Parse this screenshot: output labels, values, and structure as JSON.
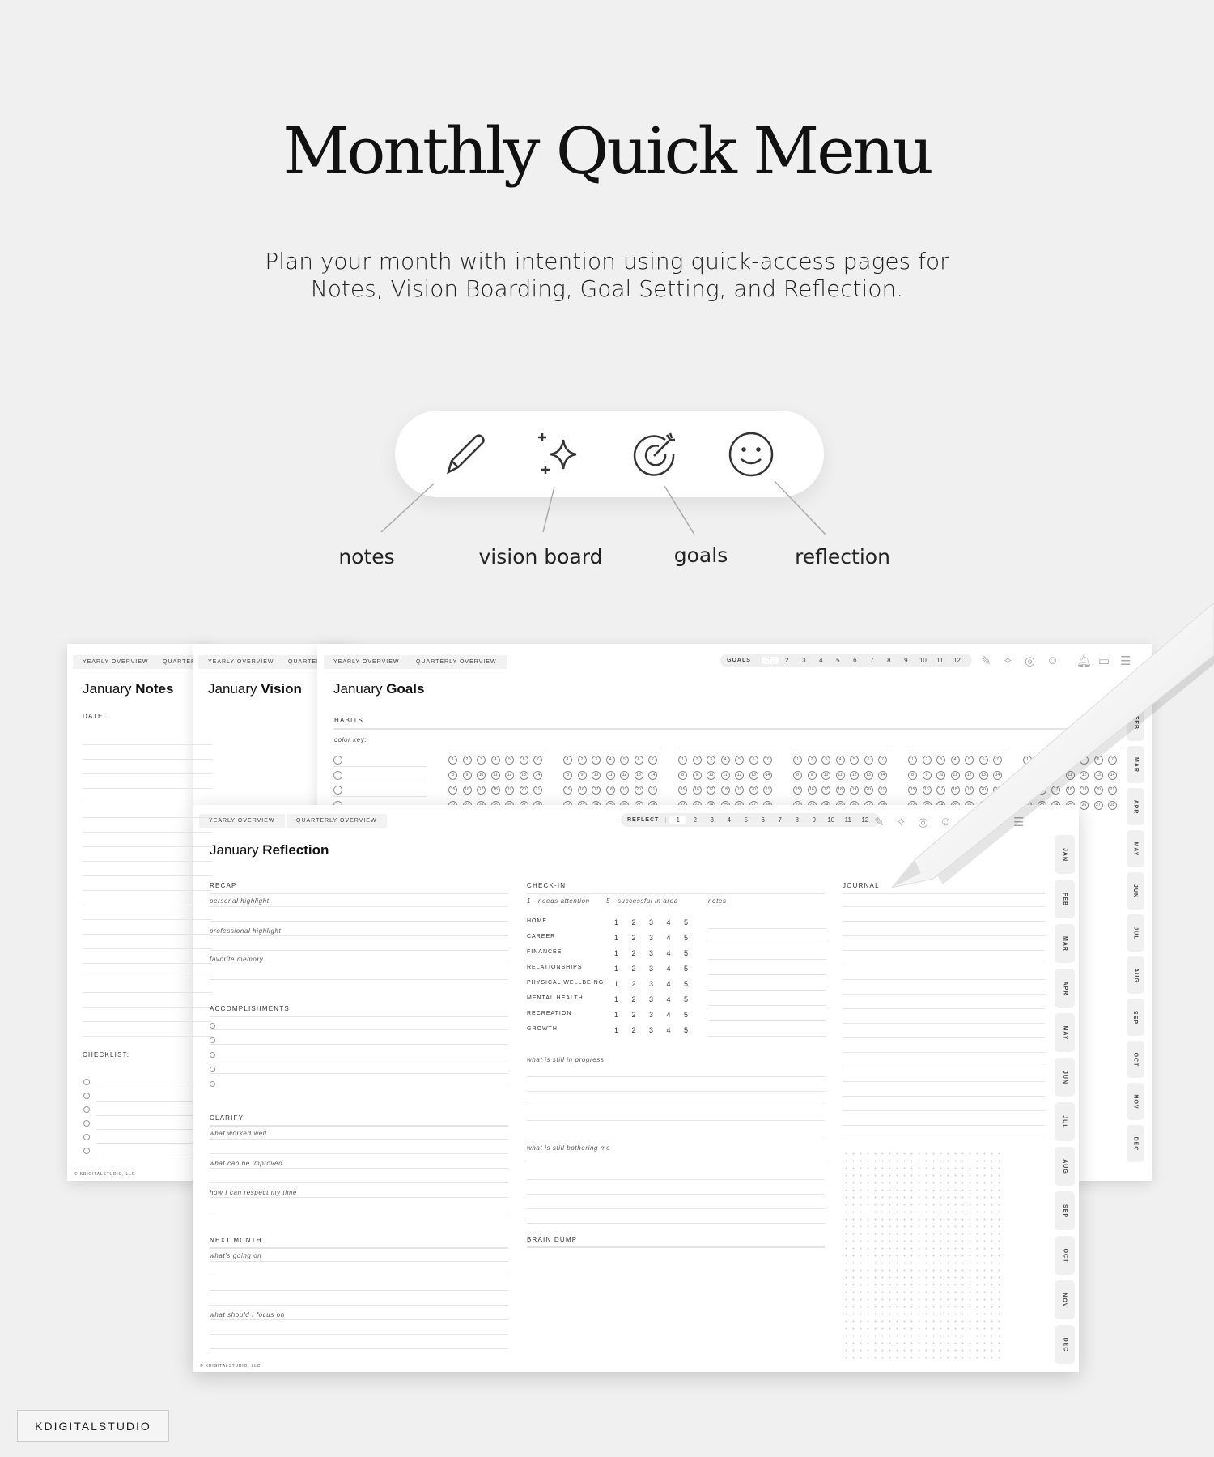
{
  "hero": {
    "title": "Monthly Quick Menu",
    "subtitle_lines": [
      "Plan your month with intention using quick-access pages for",
      "Notes, Vision Boarding, Goal Setting, and Reflection."
    ]
  },
  "quick_menu": {
    "items": [
      {
        "label": "notes",
        "icon": "pencil-icon"
      },
      {
        "label": "vision board",
        "icon": "sparkle-icon"
      },
      {
        "label": "goals",
        "icon": "target-arrow-icon"
      },
      {
        "label": "reflection",
        "icon": "smiley-icon"
      }
    ]
  },
  "common": {
    "yearly": "YEARLY OVERVIEW",
    "quarterly": "QUARTERLY OVERVIEW",
    "quarter_cut": "QUARTER",
    "footer": "© KDIGITALSTUDIO, LLC",
    "months_nums": [
      "1",
      "2",
      "3",
      "4",
      "5",
      "6",
      "7",
      "8",
      "9",
      "10",
      "11",
      "12"
    ],
    "month_tabs": [
      "JAN",
      "FEB",
      "MAR",
      "APR",
      "MAY",
      "JUN",
      "JUL",
      "AUG",
      "SEP",
      "OCT",
      "NOV",
      "DEC"
    ]
  },
  "notes_page": {
    "title_pre": "January ",
    "title_bold": "Notes",
    "date_label": "DATE:",
    "checklist_label": "CHECKLIST:"
  },
  "vision_page": {
    "title_pre": "January ",
    "title_bold": "Vision"
  },
  "goals_page": {
    "title_pre": "January ",
    "title_bold": "Goals",
    "nav_label": "GOALS",
    "habits_label": "HABITS",
    "color_key": "color key:"
  },
  "reflection_page": {
    "title_pre": "January ",
    "title_bold": "Reflection",
    "nav_label": "REFLECT",
    "recap": {
      "label": "RECAP",
      "prompts": [
        "personal highlight",
        "professional highlight",
        "favorite memory"
      ]
    },
    "accomplishments": "ACCOMPLISHMENTS",
    "clarify": {
      "label": "CLARIFY",
      "prompts": [
        "what worked well",
        "what can be improved",
        "how I can respect my time"
      ]
    },
    "next_month": {
      "label": "NEXT MONTH",
      "prompts": [
        "what's going on",
        "what should I focus on"
      ]
    },
    "checkin": {
      "label": "CHECK-IN",
      "legend_low": "1 - needs attention",
      "legend_high": "5 - successful in area",
      "notes_label": "notes",
      "scale": [
        "1",
        "2",
        "3",
        "4",
        "5"
      ],
      "areas": [
        "HOME",
        "CAREER",
        "FINANCES",
        "RELATIONSHIPS",
        "PHYSICAL WELLBEING",
        "MENTAL HEALTH",
        "RECREATION",
        "GROWTH"
      ]
    },
    "in_progress": "what is still in progress",
    "bothering": "what is still bothering me",
    "brain_dump": "BRAIN DUMP",
    "journal": "JOURNAL"
  },
  "brand": "KDIGITALSTUDIO",
  "colors": {
    "background": "#f0f0f0",
    "page": "#ffffff",
    "tab": "#f2f2f2",
    "text": "#222222"
  }
}
